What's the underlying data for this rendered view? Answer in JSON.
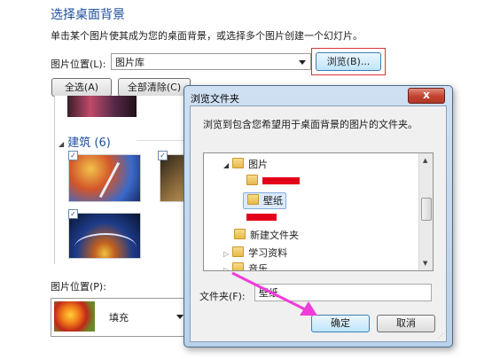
{
  "header": {
    "title": "选择桌面背景",
    "subtitle": "单击某个图片使其成为您的桌面背景，或选择多个图片创建一个幻灯片。"
  },
  "location": {
    "label": "图片位置(L):",
    "value": "图片库",
    "browse_label": "浏览(B)..."
  },
  "selection": {
    "select_all": "全选(A)",
    "clear_all": "全部清除(C)"
  },
  "group": {
    "name": "建筑 (6)"
  },
  "position": {
    "label": "图片位置(P):",
    "value": "填充"
  },
  "dialog": {
    "title": "浏览文件夹",
    "close_label": "x",
    "instruction": "浏览到包含您希望用于桌面背景的图片的文件夹。",
    "tree": [
      {
        "label": "图片",
        "expander": "◢"
      },
      {
        "label": "",
        "redacted": true
      },
      {
        "label": "壁纸",
        "selected": true
      },
      {
        "label": "",
        "redacted": true
      },
      {
        "label": "新建文件夹"
      },
      {
        "label": "学习资料",
        "expander": "▷"
      },
      {
        "label": "音乐",
        "expander": "▷"
      }
    ],
    "folder_label": "文件夹(F):",
    "folder_value": "壁纸",
    "ok_label": "确定",
    "cancel_label": "取消"
  },
  "colors": {
    "title": "#1e4e9e",
    "highlight_red": "#e3001b",
    "arrow": "#f03cd8"
  }
}
